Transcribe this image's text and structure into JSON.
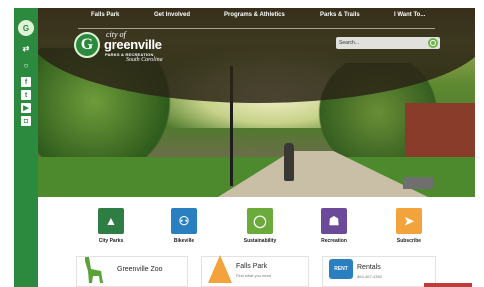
{
  "nav": {
    "items": [
      "Falls Park",
      "Get Involved",
      "Programs & Athletics",
      "Parks & Trails",
      "I Want To..."
    ]
  },
  "logo": {
    "city": "city of",
    "name": "greenville",
    "sub": "PARKS & RECREATION",
    "state": "South Carolina"
  },
  "search": {
    "placeholder": "Search..."
  },
  "quick_links": [
    {
      "label": "City Parks",
      "icon": "tree-icon",
      "color": "#2e7d45"
    },
    {
      "label": "Bikeville",
      "icon": "bike-icon",
      "color": "#2a7fc0"
    },
    {
      "label": "Sustainability",
      "icon": "leaf-circle-icon",
      "color": "#6aab3c"
    },
    {
      "label": "Recreation",
      "icon": "people-icon",
      "color": "#6b4a9a"
    },
    {
      "label": "Subscribe",
      "icon": "paper-plane-icon",
      "color": "#f2a33b"
    }
  ],
  "cards": [
    {
      "title": "Greenville Zoo",
      "icon": "giraffe-icon",
      "accent": "#5aa33a"
    },
    {
      "title": "Falls Park",
      "subtitle": "Find what you need",
      "icon": "falls-park-icon",
      "accent": "#f2a33b"
    },
    {
      "title": "Rentals",
      "subtitle": "864-467-4350",
      "icon": "rent-icon",
      "accent": "#2a7fc0",
      "badge": "RENT"
    }
  ],
  "sidebar": {
    "icons": [
      "logo-icon",
      "share-icon",
      "search-icon",
      "facebook-icon",
      "twitter-icon",
      "youtube-icon",
      "instagram-icon"
    ]
  },
  "colors": {
    "brand_green": "#2c8a3f"
  }
}
